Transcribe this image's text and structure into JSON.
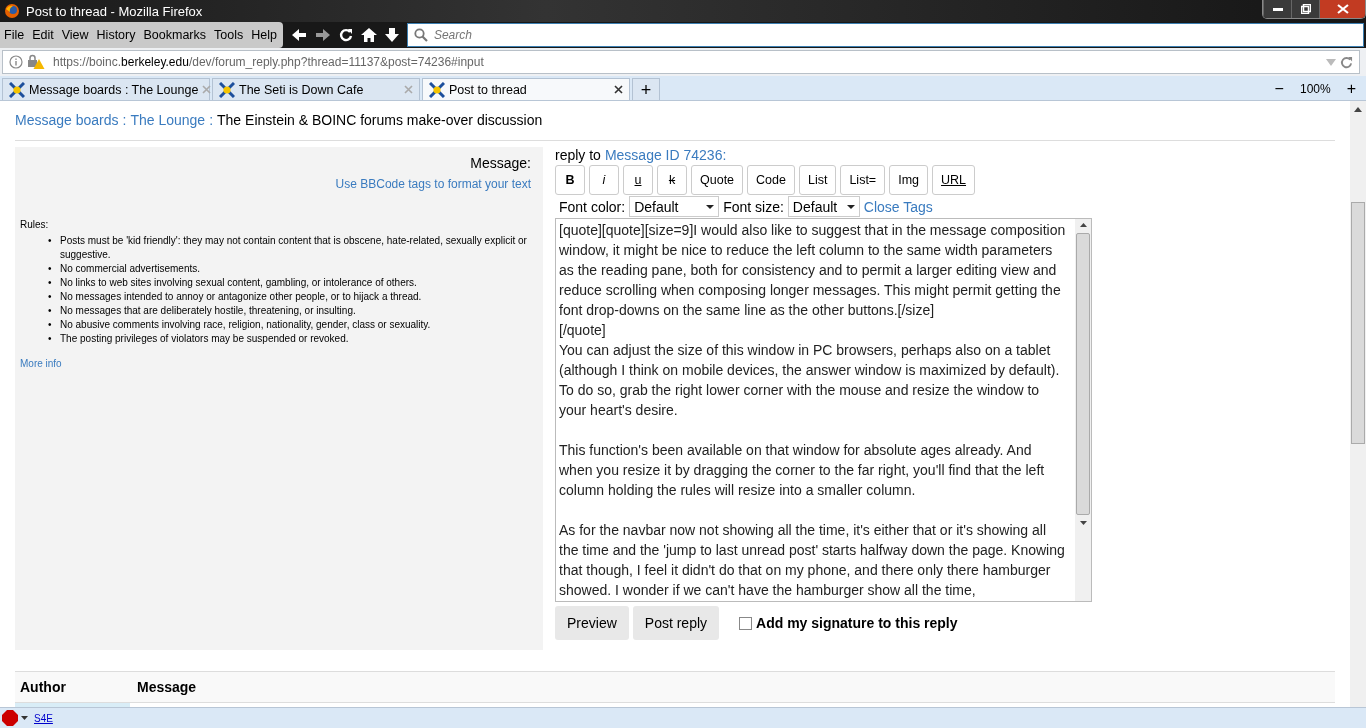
{
  "window": {
    "title": "Post to thread - Mozilla Firefox"
  },
  "menu": [
    "File",
    "Edit",
    "View",
    "History",
    "Bookmarks",
    "Tools",
    "Help"
  ],
  "search": {
    "placeholder": "Search"
  },
  "address": {
    "prefix": "https://boinc.",
    "domain": "berkeley.edu",
    "path": "/dev/forum_reply.php?thread=11137&post=74236#input"
  },
  "tabs": [
    {
      "label": "Message boards : The Lounge",
      "selected": false
    },
    {
      "label": "The Seti is Down Cafe",
      "selected": false
    },
    {
      "label": "Post to thread",
      "selected": true
    }
  ],
  "new_tab": "+",
  "zoom": {
    "minus": "−",
    "value": "100%",
    "plus": "+"
  },
  "breadcrumb": {
    "links": [
      "Message boards",
      "The Lounge"
    ],
    "separator": ":",
    "title": "The Einstein & BOINC forums make-over discussion"
  },
  "left": {
    "label": "Message:",
    "bbcode_link": "Use BBCode tags to format your text",
    "rules_title": "Rules:",
    "rules": [
      {
        "bullet": "•",
        "text": "Posts must be 'kid friendly': they may not contain content that is obscene, hate-related, sexually explicit or suggestive."
      },
      {
        "bullet": "•",
        "text": "No commercial advertisements."
      },
      {
        "bullet": "•",
        "text": "No links to web sites involving sexual content, gambling, or intolerance of others."
      },
      {
        "bullet": "•",
        "text": "No messages intended to annoy or antagonize other people, or to hijack a thread."
      },
      {
        "bullet": "•",
        "text": "No messages that are deliberately hostile, threatening, or insulting."
      },
      {
        "bullet": "•",
        "text": "No abusive comments involving race, religion, nationality, gender, class or sexuality."
      },
      {
        "bullet": "•",
        "text": "The posting privileges of violators may be suspended or revoked."
      }
    ],
    "more_info": "More info"
  },
  "reply_to": {
    "text": "reply to",
    "link": "Message ID 74236",
    "suffix": ":"
  },
  "format_buttons": [
    {
      "label": "B",
      "kind": "bold"
    },
    {
      "label": "i",
      "kind": "italic"
    },
    {
      "label": "u",
      "kind": "underline"
    },
    {
      "label": "k",
      "kind": "strike"
    },
    {
      "label": "Quote",
      "kind": "plain"
    },
    {
      "label": "Code",
      "kind": "plain"
    },
    {
      "label": "List",
      "kind": "plain"
    },
    {
      "label": "List=",
      "kind": "plain"
    },
    {
      "label": "Img",
      "kind": "plain"
    },
    {
      "label": "URL",
      "kind": "underline"
    }
  ],
  "font_color": {
    "label": "Font color:",
    "value": "Default"
  },
  "font_size": {
    "label": "Font size:",
    "value": "Default"
  },
  "close_tags": "Close Tags",
  "message_paragraphs": [
    "[quote][quote][size=9]I would also like to suggest that in the message composition window, it might be nice to reduce the left column to the same width parameters as the reading pane, both for consistency and to permit a larger editing view and reduce scrolling when composing longer messages. This might permit getting the font drop-downs on the same line as the other buttons.[/size]\n[/quote]\nYou can adjust the size of this window in PC browsers, perhaps also on a tablet (although I think on mobile devices, the answer window is maximized by default). To do so, grab the right lower corner with the mouse and resize the window to your heart's desire.",
    "This function's been available on that window for absolute ages already. And when you resize it by dragging the corner to the far right, you'll find that the left column holding the rules will resize into a smaller column.",
    "As for the navbar now not showing all the time, it's either that or it's showing all the time and the 'jump to last unread post' starts halfway down the page. Knowing that though, I feel it didn't do that on my phone, and there only there hamburger showed. I wonder if we can't have the hamburger show all the time,"
  ],
  "actions": [
    "Preview",
    "Post reply"
  ],
  "signature": {
    "label": "Add my signature to this reply",
    "checked": false
  },
  "table_header": [
    "Author",
    "Message"
  ],
  "status_bar": {
    "addon": "S4E"
  }
}
